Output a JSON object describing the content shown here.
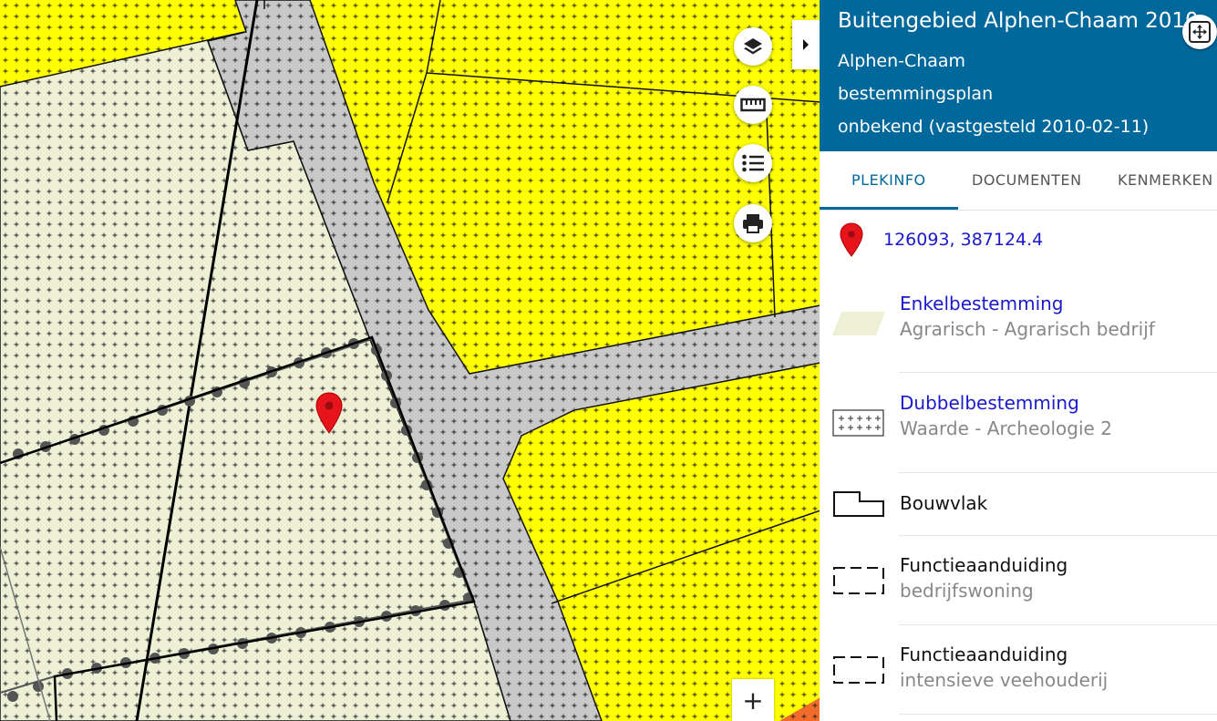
{
  "plan": {
    "title": "Buitengebied Alphen-Chaam 2010",
    "municipality": "Alphen-Chaam",
    "type": "bestemmingsplan",
    "status": "onbekend (vastgesteld 2010-02-11)"
  },
  "tabs": [
    {
      "label": "PLEKINFO",
      "active": true
    },
    {
      "label": "DOCUMENTEN",
      "active": false
    },
    {
      "label": "KENMERKEN",
      "active": false
    }
  ],
  "location": {
    "coordinates": "126093, 387124.4",
    "icon": "map-marker-icon"
  },
  "legend_items": [
    {
      "title": "Enkelbestemming",
      "subtitle": "Agrarisch - Agrarisch bedrijf",
      "symbol": "agrarisch-area-symbol",
      "link": true
    },
    {
      "title": "Dubbelbestemming",
      "subtitle": "Waarde - Archeologie 2",
      "symbol": "archeologie-hatch-symbol",
      "link": true
    },
    {
      "title": "Bouwvlak",
      "subtitle": "",
      "symbol": "bouwvlak-symbol",
      "link": false
    },
    {
      "title": "Functieaanduiding",
      "subtitle": "bedrijfswoning",
      "symbol": "dashed-box-symbol",
      "link": false
    },
    {
      "title": "Functieaanduiding",
      "subtitle": "intensieve veehouderij",
      "symbol": "dashed-box-symbol",
      "link": false
    }
  ],
  "map_controls": {
    "zoom_in": "+",
    "icons": [
      "layers-icon",
      "ruler-icon",
      "legend-list-icon",
      "print-icon",
      "chevron-right-icon",
      "fullscreen-icon"
    ]
  },
  "colors": {
    "header_bg": "#01689b",
    "yellow_zone": "#ffff00",
    "agrarisch_zone": "#eef0d6",
    "road_zone": "#c8c8c8",
    "link": "#1a1acc",
    "marker": "#e8141c"
  }
}
